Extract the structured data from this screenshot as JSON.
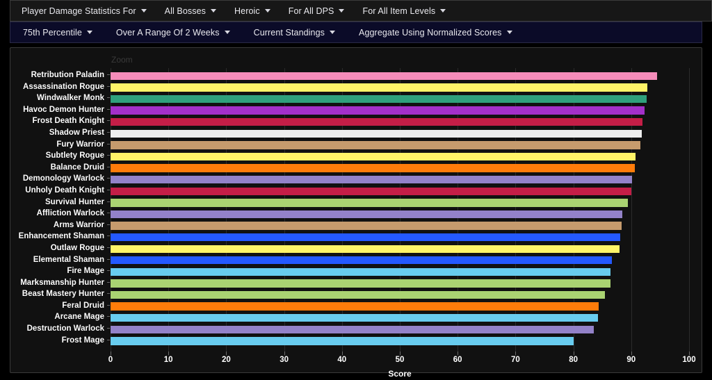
{
  "toolbars": {
    "primary": [
      {
        "label": "Player Damage Statistics For",
        "name": "menu-metric"
      },
      {
        "label": "All Bosses",
        "name": "menu-boss"
      },
      {
        "label": "Heroic",
        "name": "menu-difficulty"
      },
      {
        "label": "For All DPS",
        "name": "menu-role"
      },
      {
        "label": "For All Item Levels",
        "name": "menu-item-level"
      }
    ],
    "secondary": [
      {
        "label": "75th Percentile",
        "name": "menu-percentile"
      },
      {
        "label": "Over A Range Of 2 Weeks",
        "name": "menu-time-range"
      },
      {
        "label": "Current Standings",
        "name": "menu-standings"
      },
      {
        "label": "Aggregate Using Normalized Scores",
        "name": "menu-aggregation"
      }
    ]
  },
  "chart_panel": {
    "zoom_label": "Zoom"
  },
  "chart_data": {
    "type": "bar",
    "orientation": "horizontal",
    "title": "",
    "xlabel": "Score",
    "ylabel": "",
    "xlim": [
      0,
      100
    ],
    "xticks": [
      0,
      10,
      20,
      30,
      40,
      50,
      60,
      70,
      80,
      90,
      100
    ],
    "grid": true,
    "legend": "none",
    "categories": [
      "Retribution Paladin",
      "Assassination Rogue",
      "Windwalker Monk",
      "Havoc Demon Hunter",
      "Frost Death Knight",
      "Shadow Priest",
      "Fury Warrior",
      "Subtlety Rogue",
      "Balance Druid",
      "Demonology Warlock",
      "Unholy Death Knight",
      "Survival Hunter",
      "Affliction Warlock",
      "Arms Warrior",
      "Enhancement Shaman",
      "Outlaw Rogue",
      "Elemental Shaman",
      "Fire Mage",
      "Marksmanship Hunter",
      "Beast Mastery Hunter",
      "Feral Druid",
      "Arcane Mage",
      "Destruction Warlock",
      "Frost Mage"
    ],
    "values": [
      94.5,
      92.8,
      92.7,
      92.3,
      91.9,
      91.8,
      91.6,
      90.7,
      90.6,
      90.1,
      90.0,
      89.4,
      88.5,
      88.4,
      88.1,
      88.0,
      86.6,
      86.4,
      86.4,
      85.4,
      84.4,
      84.3,
      83.5,
      80.1
    ],
    "colors": [
      "#f58cba",
      "#fff468",
      "#2fa07c",
      "#a330c9",
      "#c41e47",
      "#eeeeee",
      "#c69b6d",
      "#fff468",
      "#ff7c0a",
      "#9382c9",
      "#c41e47",
      "#aad372",
      "#9382c9",
      "#c69b6d",
      "#2459ff",
      "#fff468",
      "#2459ff",
      "#68ccef",
      "#aad372",
      "#aad372",
      "#ff7c0a",
      "#68ccef",
      "#9382c9",
      "#68ccef"
    ]
  }
}
